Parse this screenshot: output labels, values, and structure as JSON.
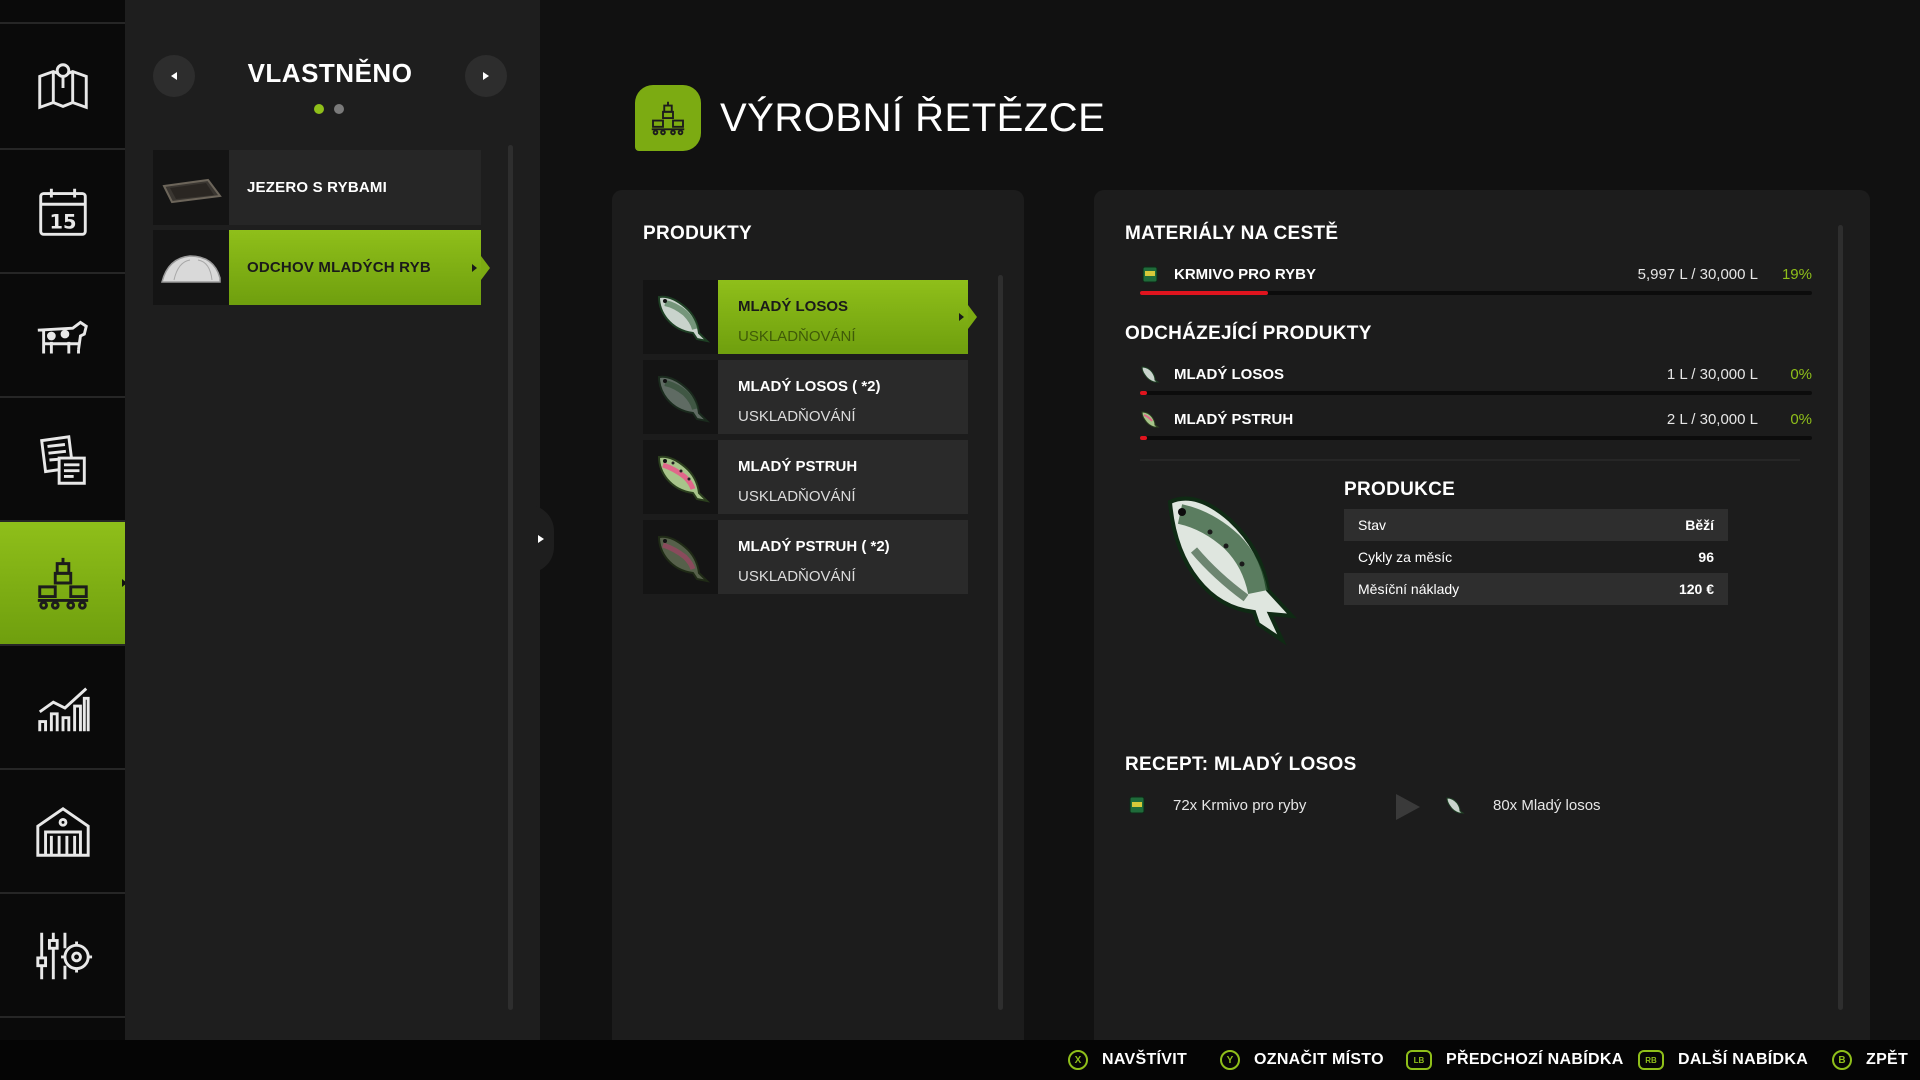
{
  "nav": {
    "items": [
      {
        "icon": "map-icon"
      },
      {
        "icon": "calendar-icon",
        "badge": "15"
      },
      {
        "icon": "cow-icon"
      },
      {
        "icon": "contracts-icon"
      },
      {
        "icon": "production-icon",
        "active": true
      },
      {
        "icon": "statistics-icon"
      },
      {
        "icon": "barn-icon"
      },
      {
        "icon": "settings-icon"
      }
    ]
  },
  "list": {
    "title": "VLASTNĚNO",
    "pages": 2,
    "current_page": 1,
    "items": [
      {
        "label": "JEZERO S RYBAMI",
        "active": false
      },
      {
        "label": "ODCHOV MLADÝCH RYB",
        "active": true
      }
    ]
  },
  "header": {
    "title": "VÝROBNÍ ŘETĚZCE",
    "icon": "production-icon"
  },
  "products": {
    "title": "PRODUKTY",
    "items": [
      {
        "name": "MLADÝ LOSOS",
        "state": "USKLADŇOVÁNÍ",
        "icon": "salmon-icon",
        "active": true
      },
      {
        "name": "MLADÝ LOSOS ( *2)",
        "state": "USKLADŇOVÁNÍ",
        "icon": "salmon-icon",
        "active": false
      },
      {
        "name": "MLADÝ PSTRUH",
        "state": "USKLADŇOVÁNÍ",
        "icon": "trout-icon",
        "active": false
      },
      {
        "name": "MLADÝ PSTRUH ( *2)",
        "state": "USKLADŇOVÁNÍ",
        "icon": "trout-icon",
        "active": false
      }
    ]
  },
  "materials": {
    "title": "MATERIÁLY NA CESTĚ",
    "items": [
      {
        "name": "KRMIVO PRO RYBY",
        "amount": "5,997 L / 30,000 L",
        "percent": "19%",
        "fill": 0.19,
        "icon": "fish-food-icon"
      }
    ]
  },
  "outgoing": {
    "title": "ODCHÁZEJÍCÍ PRODUKTY",
    "items": [
      {
        "name": "MLADÝ LOSOS",
        "amount": "1 L / 30,000 L",
        "percent": "0%",
        "fill": 0.0,
        "icon": "salmon-icon"
      },
      {
        "name": "MLADÝ PSTRUH",
        "amount": "2 L / 30,000 L",
        "percent": "0%",
        "fill": 0.0,
        "icon": "trout-icon"
      }
    ]
  },
  "production": {
    "title": "PRODUKCE",
    "rows": [
      {
        "key": "Stav",
        "value": "Běží"
      },
      {
        "key": "Cykly za měsíc",
        "value": "96"
      },
      {
        "key": "Měsíční náklady",
        "value": "120 €"
      }
    ]
  },
  "recipe": {
    "title": "RECEPT: MLADÝ LOSOS",
    "input": "72x Krmivo pro ryby",
    "output": "80x Mladý losos"
  },
  "hints": [
    {
      "button": "X",
      "label": "NAVŠTÍVIT"
    },
    {
      "button": "Y",
      "label": "OZNAČIT MÍSTO"
    },
    {
      "button": "LB",
      "label": "PŘEDCHOZÍ NABÍDKA"
    },
    {
      "button": "RB",
      "label": "DALŠÍ NABÍDKA"
    },
    {
      "button": "B",
      "label": "ZPĚT"
    }
  ],
  "colors": {
    "accent": "#8fbf1a",
    "accent_dark": "#6f9f0e",
    "bar_fill": "#e0141e",
    "panel": "#1c1c1c",
    "background": "#111111"
  }
}
